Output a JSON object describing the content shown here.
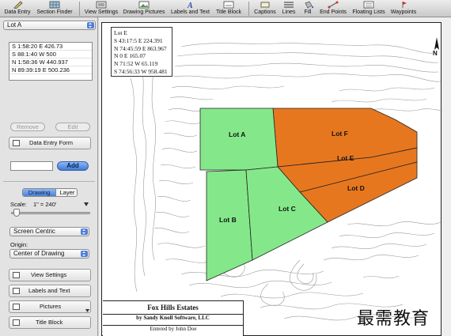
{
  "toolbar": {
    "buttons": [
      {
        "label": "Data Entry"
      },
      {
        "label": "Section Finder"
      },
      {
        "label": "View Settings"
      },
      {
        "label": "Drawing Pictures"
      },
      {
        "label": "Labels and Text"
      },
      {
        "label": "Title Block"
      },
      {
        "label": "Captions"
      },
      {
        "label": "Lines"
      },
      {
        "label": "Fill"
      },
      {
        "label": "End Points"
      },
      {
        "label": "Floating Lists"
      },
      {
        "label": "Waypoints"
      }
    ]
  },
  "left_panel": {
    "lot_select": "Lot A",
    "calls": [
      "S 1:58:20 E 426.73",
      "S 88:1:40 W 500",
      "N 1:58:36 W 440.937",
      "N 89:39:19 E 500.236"
    ],
    "remove_label": "Remove",
    "edit_label": "Edit",
    "data_entry_form_label": "Data Entry Form",
    "add_input_value": "",
    "add_label": "Add",
    "tab_drawing": "Drawing",
    "tab_layer": "Layer",
    "scale_label": "Scale:",
    "scale_value": "1\" = 240'",
    "centric_select": "Screen Centric",
    "origin_label": "Origin:",
    "origin_select": "Center of Drawing",
    "view_settings_label": "View Settings",
    "labels_text_label": "Labels and Text",
    "pictures_label": "Pictures",
    "title_block_label": "Title Block"
  },
  "drawing": {
    "legal_box": {
      "title": "Lot E",
      "lines": [
        "S 43:17:5 E 224.391",
        "N 74:45:59 E 863.967",
        "N 0 E 165.07",
        "N 71:52 W 65.119",
        "S 74:56:33 W 958.481"
      ]
    },
    "lots": {
      "a": "Lot A",
      "b": "Lot B",
      "c": "Lot C",
      "d": "Lot D",
      "e": "Lot E",
      "f": "Lot F"
    },
    "colors": {
      "green_lots": "#84e88a",
      "orange_lots": "#e7771f"
    },
    "north_label": "N",
    "title_block": {
      "title": "Fox Hills Estates",
      "subtitle": "by Sandy Knoll Software, LLC",
      "entered_by": "Entered by John Doe"
    }
  },
  "watermark": "最需教育"
}
